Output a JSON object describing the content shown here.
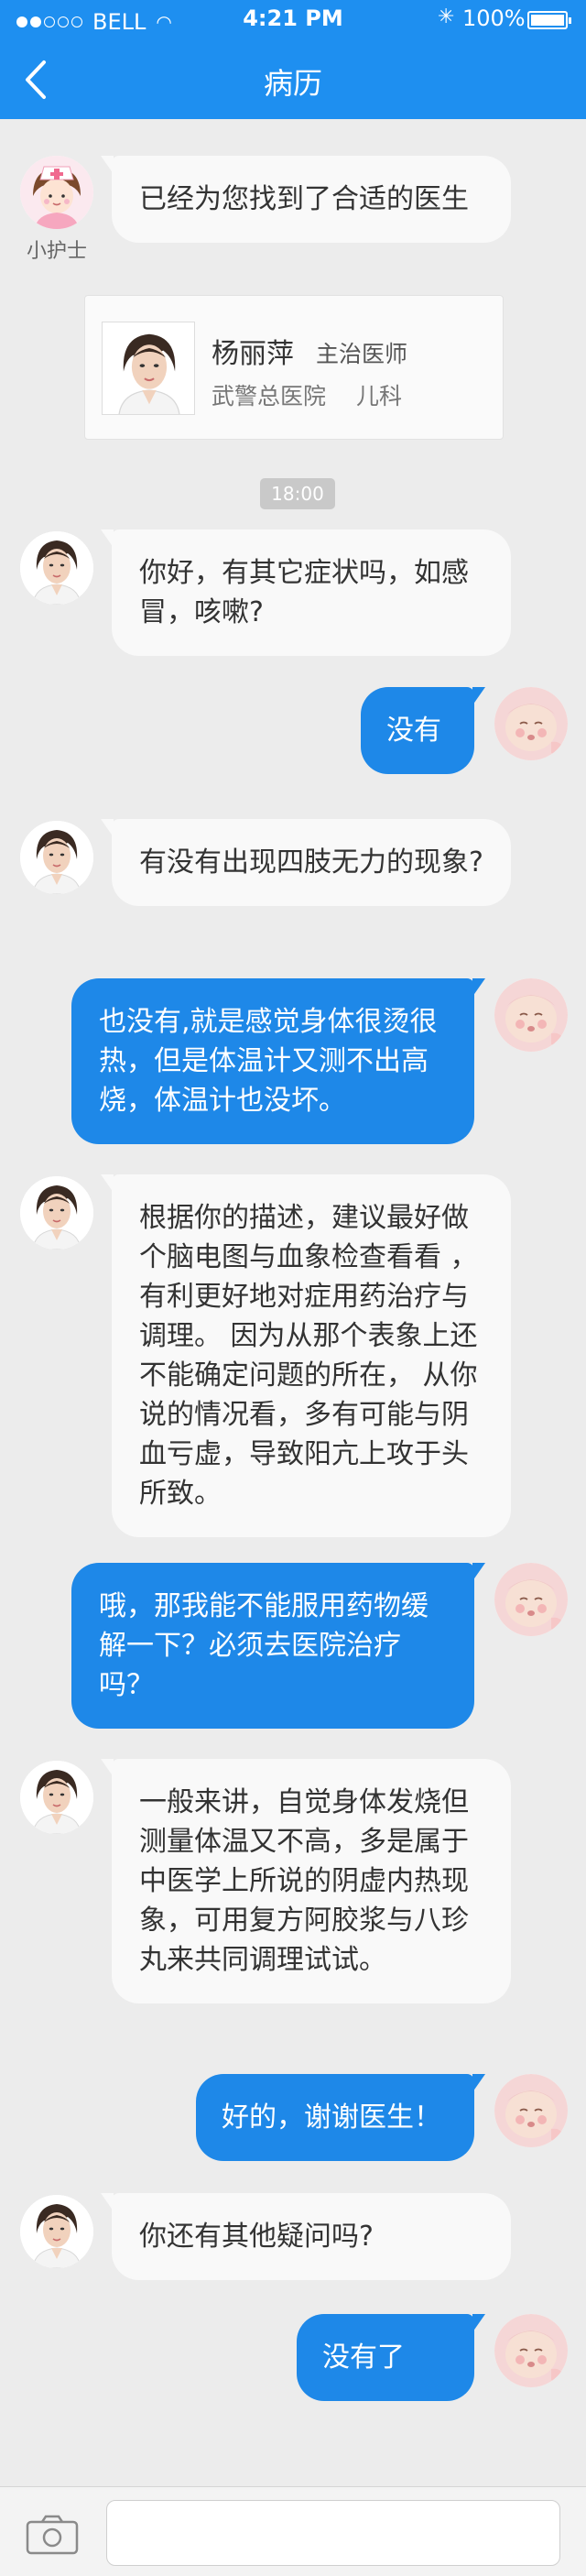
{
  "status_bar": {
    "carrier": "BELL",
    "time": "4:21 PM",
    "battery": "100%"
  },
  "header": {
    "title": "病历"
  },
  "nurse": {
    "label": "小护士",
    "message": "已经为您找到了合适的医生"
  },
  "doctor_card": {
    "name": "杨丽萍",
    "title": "主治医师",
    "hospital": "武警总医院",
    "department": "儿科"
  },
  "timestamp": "18:00",
  "messages": [
    {
      "from": "doctor",
      "text": "你好，有其它症状吗，如感冒，咳嗽?"
    },
    {
      "from": "patient",
      "text": "没有"
    },
    {
      "from": "doctor",
      "text": "有没有出现四肢无力的现象?"
    },
    {
      "from": "patient",
      "text": "也没有,就是感觉身体很烫很热，但是体温计又测不出高烧，体温计也没坏。"
    },
    {
      "from": "doctor",
      "text": "根据你的描述，建议最好做个脑电图与血象检查看看 ，有利更好地对症用药治疗与调理。 因为从那个表象上还不能确定问题的所在， 从你说的情况看，多有可能与阴血亏虚，导致阳亢上攻于头所致。"
    },
    {
      "from": "patient",
      "text": "哦，那我能不能服用药物缓解一下？必须去医院治疗吗？"
    },
    {
      "from": "doctor",
      "text": "一般来讲，自觉身体发烧但测量体温又不高，多是属于中医学上所说的阴虚内热现象，可用复方阿胶浆与八珍丸来共同调理试试。"
    },
    {
      "from": "patient",
      "text": "好的，谢谢医生！"
    },
    {
      "from": "doctor",
      "text": "你还有其他疑问吗?"
    },
    {
      "from": "patient",
      "text": "没有了"
    }
  ],
  "input": {
    "value": ""
  }
}
